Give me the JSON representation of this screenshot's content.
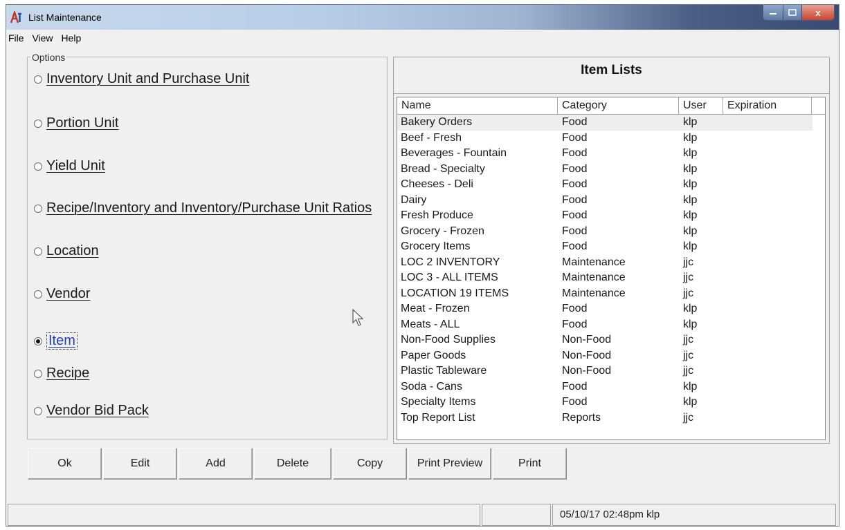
{
  "window": {
    "title": "List Maintenance",
    "app_icon": "app-logo-icon",
    "controls": {
      "minimize": "minimize-icon",
      "maximize": "maximize-icon",
      "close": "close-icon",
      "close_glyph": "x"
    }
  },
  "menu": [
    "File",
    "View",
    "Help"
  ],
  "options": {
    "legend": "Options",
    "items": [
      {
        "label": "Inventory Unit and Purchase Unit",
        "selected": false
      },
      {
        "label": "Portion Unit",
        "selected": false
      },
      {
        "label": "Yield Unit",
        "selected": false
      },
      {
        "label": "Recipe/Inventory and Inventory/Purchase Unit Ratios",
        "selected": false
      },
      {
        "label": "Location",
        "selected": false
      },
      {
        "label": "Vendor",
        "selected": false
      },
      {
        "label": "Item",
        "selected": true
      },
      {
        "label": "Recipe",
        "selected": false
      },
      {
        "label": "Vendor Bid Pack",
        "selected": false
      }
    ]
  },
  "item_lists": {
    "title": "Item Lists",
    "columns": [
      "Name",
      "Category",
      "User",
      "Expiration"
    ],
    "rows": [
      [
        "Bakery Orders",
        "Food",
        "klp",
        ""
      ],
      [
        "Beef - Fresh",
        "Food",
        "klp",
        ""
      ],
      [
        "Beverages - Fountain",
        "Food",
        "klp",
        ""
      ],
      [
        "Bread - Specialty",
        "Food",
        "klp",
        ""
      ],
      [
        "Cheeses - Deli",
        "Food",
        "klp",
        ""
      ],
      [
        "Dairy",
        "Food",
        "klp",
        ""
      ],
      [
        "Fresh Produce",
        "Food",
        "klp",
        ""
      ],
      [
        "Grocery - Frozen",
        "Food",
        "klp",
        ""
      ],
      [
        "Grocery Items",
        "Food",
        "klp",
        ""
      ],
      [
        "LOC 2 INVENTORY",
        "Maintenance",
        "jjc",
        ""
      ],
      [
        "LOC 3 - ALL ITEMS",
        "Maintenance",
        "jjc",
        ""
      ],
      [
        "LOCATION 19 ITEMS",
        "Maintenance",
        "jjc",
        ""
      ],
      [
        "Meat - Frozen",
        "Food",
        "klp",
        ""
      ],
      [
        "Meats - ALL",
        "Food",
        "klp",
        ""
      ],
      [
        "Non-Food Supplies",
        "Non-Food",
        "jjc",
        ""
      ],
      [
        "Paper Goods",
        "Non-Food",
        "jjc",
        ""
      ],
      [
        "Plastic Tableware",
        "Non-Food",
        "jjc",
        ""
      ],
      [
        "Soda - Cans",
        "Food",
        "klp",
        ""
      ],
      [
        "Specialty Items",
        "Food",
        "klp",
        ""
      ],
      [
        "Top Report List",
        "Reports",
        "jjc",
        ""
      ]
    ]
  },
  "buttons": [
    "Ok",
    "Edit",
    "Add",
    "Delete",
    "Copy",
    "Print Preview",
    "Print"
  ],
  "status": {
    "left": "",
    "middle": "",
    "right": "05/10/17 02:48pm klp"
  },
  "colors": {
    "selected_option": "#1f3fbf",
    "title_bar_end": "#394b72",
    "close_button": "#c7462f"
  }
}
